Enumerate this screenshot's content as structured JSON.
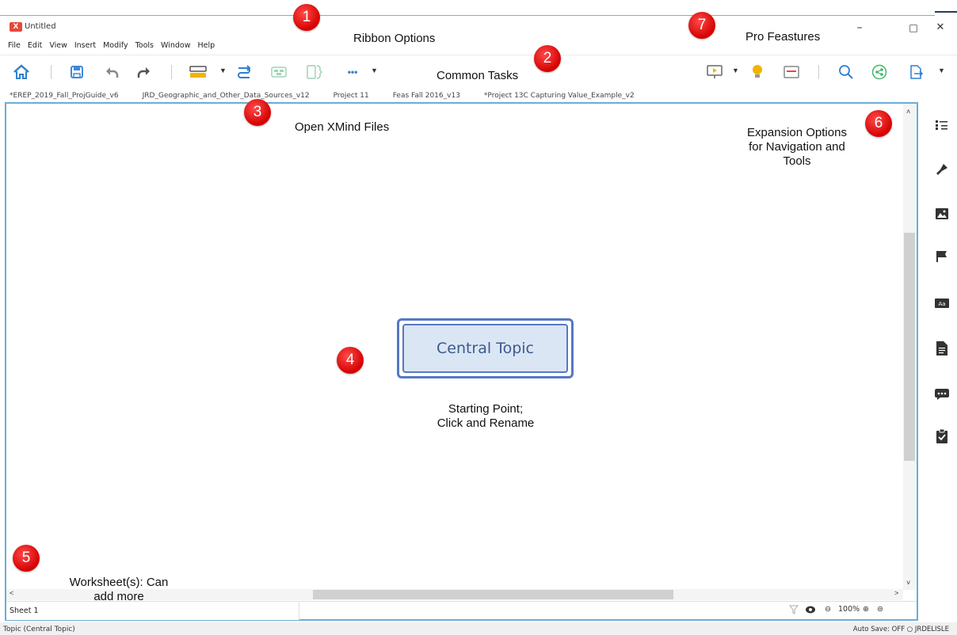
{
  "window": {
    "app_logo": "X",
    "title": "Untitled",
    "minimize": "–",
    "maximize": "□",
    "close": "✕"
  },
  "menu": [
    "File",
    "Edit",
    "View",
    "Insert",
    "Modify",
    "Tools",
    "Window",
    "Help"
  ],
  "toolbar": {
    "icons": [
      "home-icon",
      "save-icon",
      "undo-icon",
      "redo-icon",
      "topic-style-icon",
      "relationship-icon",
      "boundary-icon",
      "summary-icon",
      "more-icon",
      "presentation-icon",
      "idea-icon",
      "gantt-icon",
      "search-icon",
      "share-icon",
      "export-icon"
    ],
    "more_label": "•••"
  },
  "file_tabs": [
    "*EREP_2019_Fall_ProjGuide_v6",
    "JRD_Geographic_and_Other_Data_Sources_v12",
    "Project 11",
    "Feas Fall 2016_v13",
    "*Project 13C Capturing Value_Example_v2"
  ],
  "canvas": {
    "central_topic": "Central Topic"
  },
  "sidebar": {
    "icons": [
      "outliner-icon",
      "format-brush-icon",
      "image-icon",
      "marker-flag-icon",
      "label-icon",
      "notes-icon",
      "comments-icon",
      "task-icon"
    ]
  },
  "sheet": {
    "tab": "Sheet 1",
    "zoom": "100%"
  },
  "status": {
    "left": "Topic (Central Topic)",
    "right": "Auto Save: OFF  ○ JRDELISLE"
  },
  "annotations": [
    {
      "num": "1",
      "text": "Ribbon Options"
    },
    {
      "num": "2",
      "text": "Common Tasks"
    },
    {
      "num": "3",
      "text": "Open XMind Files"
    },
    {
      "num": "4",
      "text": ""
    },
    {
      "num": "5",
      "text": ""
    },
    {
      "num": "6",
      "text": "Expansion Options for Navigation and Tools"
    },
    {
      "num": "7",
      "text": "Pro Feastures"
    }
  ],
  "notes": {
    "starting_point_1": "Starting Point;",
    "starting_point_2": "Click and Rename",
    "expansion_1": "Expansion Options",
    "expansion_2": "for Navigation and",
    "expansion_3": "Tools",
    "worksheets_1": "Worksheet(s): Can",
    "worksheets_2": "add more"
  },
  "colors": {
    "canvas_border": "#6aaed6",
    "topic_border": "#5678c2",
    "topic_fill": "#dbe6f4",
    "badge": "#e00000"
  }
}
